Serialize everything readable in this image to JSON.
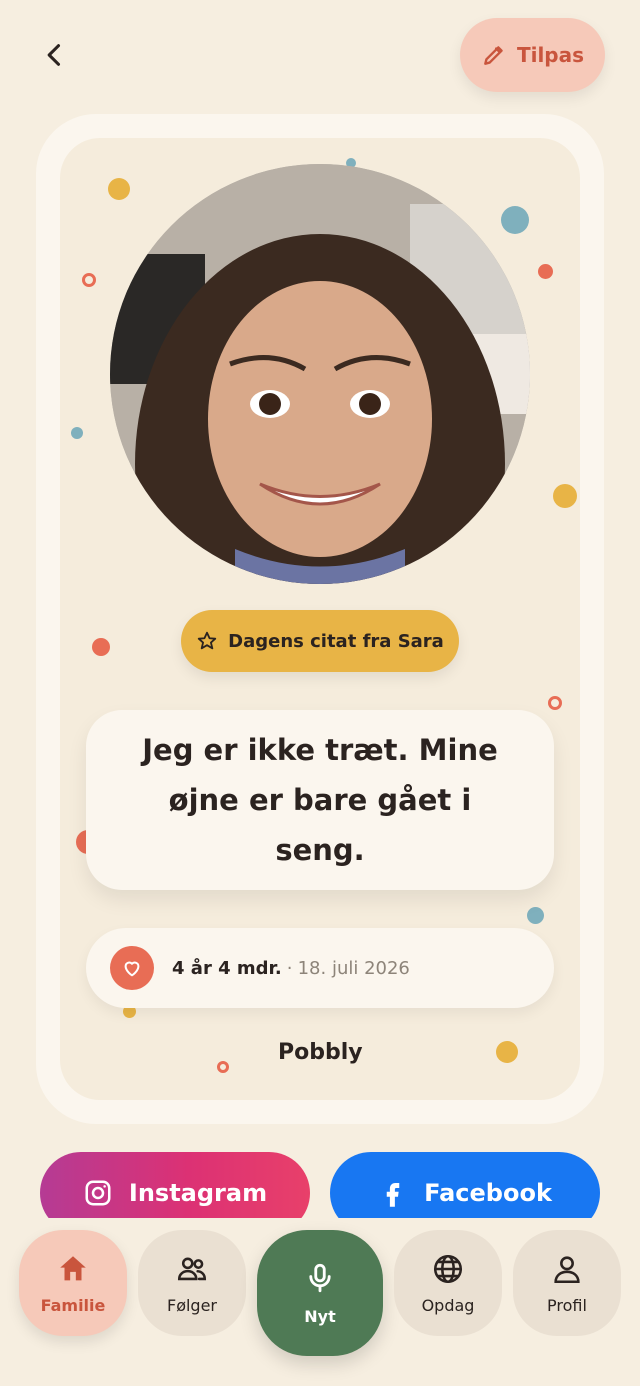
{
  "header": {
    "back_icon": "chevron-left-icon",
    "edit_label": "Tilpas",
    "edit_icon": "pencil-icon"
  },
  "card": {
    "badge_label": "Dagens citat fra Sara",
    "badge_icon": "star-icon",
    "quote": "Jeg er ikke træt. Mine øjne er bare gået i seng.",
    "age": "4 år 4 mdr.",
    "separator": "·",
    "date": "18. juli 2026",
    "brand": "Pobbly"
  },
  "share": {
    "instagram_label": "Instagram",
    "facebook_label": "Facebook"
  },
  "nav": {
    "items": [
      {
        "label": "Familie",
        "icon": "home-icon"
      },
      {
        "label": "Følger",
        "icon": "users-icon"
      },
      {
        "label": "Nyt",
        "icon": "microphone-icon"
      },
      {
        "label": "Opdag",
        "icon": "globe-icon"
      },
      {
        "label": "Profil",
        "icon": "user-icon"
      }
    ]
  },
  "colors": {
    "background": "#f6eee0",
    "accent": "#e86d55",
    "badge": "#e8b446",
    "nav_active": "#f6c9b9",
    "record": "#4f7a55",
    "instagram": "#dc3174",
    "facebook": "#1877f2"
  }
}
